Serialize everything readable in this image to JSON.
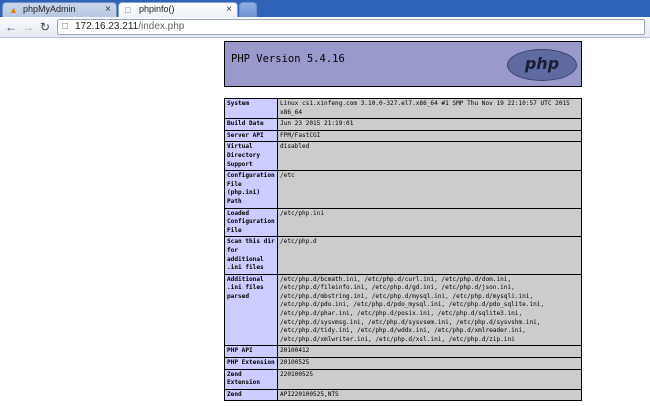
{
  "browser": {
    "tabs": [
      {
        "title": "phpMyAdmin",
        "favicon": "phpmyadmin-icon",
        "active": false
      },
      {
        "title": "phpinfo()",
        "favicon": "page-icon",
        "active": true
      }
    ],
    "close_glyph": "×",
    "url_host": "172.16.23.211",
    "url_path": "/index.php"
  },
  "page": {
    "version": "PHP Version 5.4.16",
    "logo_text": "php",
    "rows": [
      {
        "label": "System",
        "value": "Linux cs1.xinfeng.com 3.10.0-327.el7.x86_64 #1 SMP Thu Nov 19 22:10:57 UTC 2015 x86_64"
      },
      {
        "label": "Build Date",
        "value": "Jun 23 2015 21:19:01"
      },
      {
        "label": "Server API",
        "value": "FPM/FastCGI"
      },
      {
        "label": "Virtual Directory Support",
        "value": "disabled"
      },
      {
        "label": "Configuration File (php.ini) Path",
        "value": "/etc"
      },
      {
        "label": "Loaded Configuration File",
        "value": "/etc/php.ini"
      },
      {
        "label": "Scan this dir for additional .ini files",
        "value": "/etc/php.d"
      },
      {
        "label": "Additional .ini files parsed",
        "value": "/etc/php.d/bcmath.ini, /etc/php.d/curl.ini, /etc/php.d/dom.ini, /etc/php.d/fileinfo.ini, /etc/php.d/gd.ini, /etc/php.d/json.ini, /etc/php.d/mbstring.ini, /etc/php.d/mysql.ini, /etc/php.d/mysqli.ini, /etc/php.d/pdo.ini, /etc/php.d/pdo_mysql.ini, /etc/php.d/pdo_sqlite.ini, /etc/php.d/phar.ini, /etc/php.d/posix.ini, /etc/php.d/sqlite3.ini, /etc/php.d/sysvmsg.ini, /etc/php.d/sysvsem.ini, /etc/php.d/sysvshm.ini, /etc/php.d/tidy.ini, /etc/php.d/wddx.ini, /etc/php.d/xmlreader.ini, /etc/php.d/xmlwriter.ini, /etc/php.d/xsl.ini, /etc/php.d/zip.ini"
      },
      {
        "label": "PHP API",
        "value": "20100412"
      },
      {
        "label": "PHP Extension",
        "value": "20100525"
      },
      {
        "label": "Zend Extension",
        "value": "220100525"
      },
      {
        "label": "Zend",
        "value": "API220100525,NTS"
      }
    ]
  }
}
